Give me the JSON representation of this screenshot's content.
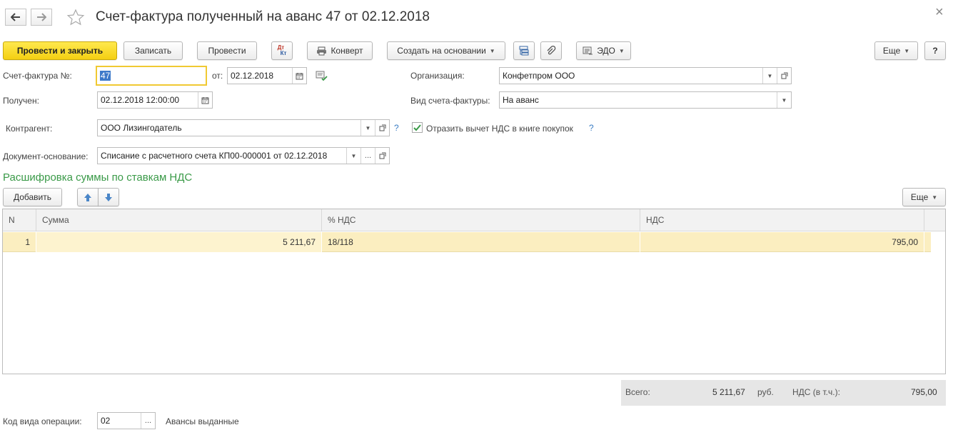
{
  "header": {
    "title": "Счет-фактура полученный на аванс 47 от 02.12.2018",
    "close_glyph": "×",
    "back_glyph": "🡐",
    "forward_glyph": "🡒"
  },
  "toolbar": {
    "post_close": "Провести и закрыть",
    "save": "Записать",
    "post": "Провести",
    "dtkt_top": "Дт",
    "dtkt_bottom": "Кт",
    "envelope": "Конверт",
    "create_based": "Создать на основании",
    "edo": "ЭДО",
    "more": "Еще",
    "help": "?"
  },
  "form": {
    "invoice_label": "Счет-фактура №:",
    "invoice_number": "47",
    "from_label": "от:",
    "invoice_date": "02.12.2018",
    "received_label": "Получен:",
    "received_value": "02.12.2018 12:00:00",
    "org_label": "Организация:",
    "org_value": "Конфетпром ООО",
    "kind_label": "Вид счета-фактуры:",
    "kind_value": "На аванс",
    "counterparty_label": "Контрагент:",
    "counterparty_value": "ООО Лизингодатель",
    "reflect_label": "Отразить вычет НДС в книге покупок",
    "reflect_checked": true,
    "basis_label": "Документ-основание:",
    "basis_value": "Списание с расчетного счета КП00-000001 от 02.12.2018",
    "ellipsis": "...",
    "question": "?"
  },
  "section": {
    "title": "Расшифровка суммы по ставкам НДС",
    "add": "Добавить",
    "more": "Еще"
  },
  "table": {
    "columns": [
      "N",
      "Сумма",
      "% НДС",
      "НДС"
    ],
    "rows": [
      {
        "n": "1",
        "sum": "5 211,67",
        "rate": "18/118",
        "vat": "795,00"
      }
    ]
  },
  "totals": {
    "total_label": "Всего:",
    "total_value": "5 211,67",
    "currency": "руб.",
    "vat_label": "НДС (в т.ч.):",
    "vat_value": "795,00"
  },
  "footer": {
    "op_code_label": "Код вида операции:",
    "op_code_value": "02",
    "op_code_desc": "Авансы выданные"
  },
  "colors": {
    "primary_button": "#f4cf12",
    "section_title": "#3a9a48",
    "row_highlight": "#fbeec0",
    "focus_border": "#f0c932",
    "help_link": "#3c7ec4"
  }
}
